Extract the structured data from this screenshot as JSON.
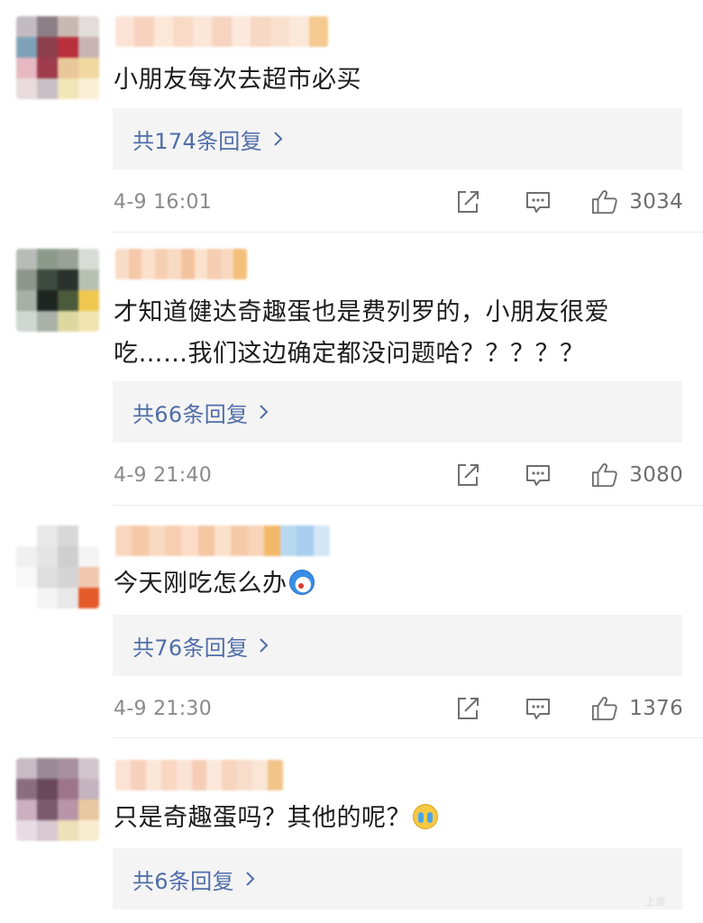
{
  "comments": [
    {
      "text": "小朋友每次去超市必买",
      "reply_label": "共174条回复",
      "timestamp": "4-9 16:01",
      "likes": "3034",
      "avatar_colors": [
        "#c2bcc0",
        "#8b7f86",
        "#c8b8b2",
        "#e2dcda",
        "#7fa1b8",
        "#8b3f4a",
        "#b8303c",
        "#c9b3b3",
        "#e6b9c2",
        "#9e3b4c",
        "#e8c89a",
        "#f0d8a0",
        "#e8dcdc",
        "#c8c0c4",
        "#f2e5b8",
        "#faf0d6"
      ],
      "username_colors": [
        "#fbe4d6",
        "#f7d2bf",
        "#fde8d8",
        "#f8dac6",
        "#fbe6d8",
        "#f6d4c0",
        "#fce9dc",
        "#f7d8c4",
        "#f9e0cd",
        "#fbe8d8",
        "#f5c98f"
      ]
    },
    {
      "text": "才知道健达奇趣蛋也是费列罗的，小朋友很爱吃……我们这边确定都没问题哈？？？？？",
      "reply_label": "共66条回复",
      "timestamp": "4-9 21:40",
      "likes": "3080",
      "avatar_colors": [
        "#b8bcb8",
        "#8c9a8c",
        "#9aa298",
        "#d8dcd6",
        "#8c968c",
        "#3c4a40",
        "#2a302c",
        "#b8c0b4",
        "#a6b0a6",
        "#1e2420",
        "#4a5a3a",
        "#f0c850",
        "#d0d6d0",
        "#a8b0a8",
        "#dcd8a0",
        "#f2e4b0"
      ],
      "username_colors": [
        "#f9dcc6",
        "#f4c8a8",
        "#fbe0cc",
        "#f6cfb2",
        "#f9dac2",
        "#f3c39e",
        "#fbe2cc",
        "#f5cdb0",
        "#f8d8bf",
        "#f4bf7a"
      ]
    },
    {
      "text": "今天刚吃怎么办",
      "emoji": "doraemon",
      "reply_label": "共76条回复",
      "timestamp": "4-9 21:30",
      "likes": "1376",
      "avatar_colors": [
        "#ffffff",
        "#e8e8e8",
        "#d8d8d8",
        "#ffffff",
        "#f0f0f0",
        "#e4e4e4",
        "#cfcfcf",
        "#f4f4f4",
        "#f8f8f8",
        "#dedede",
        "#d4d4d4",
        "#f0c8b0",
        "#ffffff",
        "#f4f4f4",
        "#e8e8e8",
        "#e45a2a"
      ],
      "username_colors": [
        "#f9d6bd",
        "#f6c9a6",
        "#fad9c2",
        "#f7cfb0",
        "#fbdcc6",
        "#f5c6a2",
        "#fbe0cc",
        "#f6caa8",
        "#f8d4b8",
        "#f4b86a",
        "#b8d8ee",
        "#a8cdee",
        "#d2e6f6"
      ]
    },
    {
      "text": "只是奇趣蛋吗？其他的呢？",
      "emoji": "cry",
      "reply_label": "共6条回复",
      "avatar_colors": [
        "#c8bcc4",
        "#9a8a96",
        "#a8909e",
        "#d2c6cc",
        "#8a6e80",
        "#6a4a5a",
        "#9c7688",
        "#c4b4c0",
        "#ccb0c0",
        "#7a5a6c",
        "#b896a8",
        "#e8c8a0",
        "#e8dce4",
        "#d8c8d2",
        "#eee0b8",
        "#f8ecd0"
      ],
      "username_colors": [
        "#fbe2d2",
        "#f7d0bc",
        "#fce6d8",
        "#f8d6c2",
        "#fbe4d4",
        "#f6ceb8",
        "#fce8da",
        "#f7d4be",
        "#f8ddcb",
        "#fbe6d6",
        "#f3c48a"
      ]
    }
  ],
  "watermark": "上游"
}
